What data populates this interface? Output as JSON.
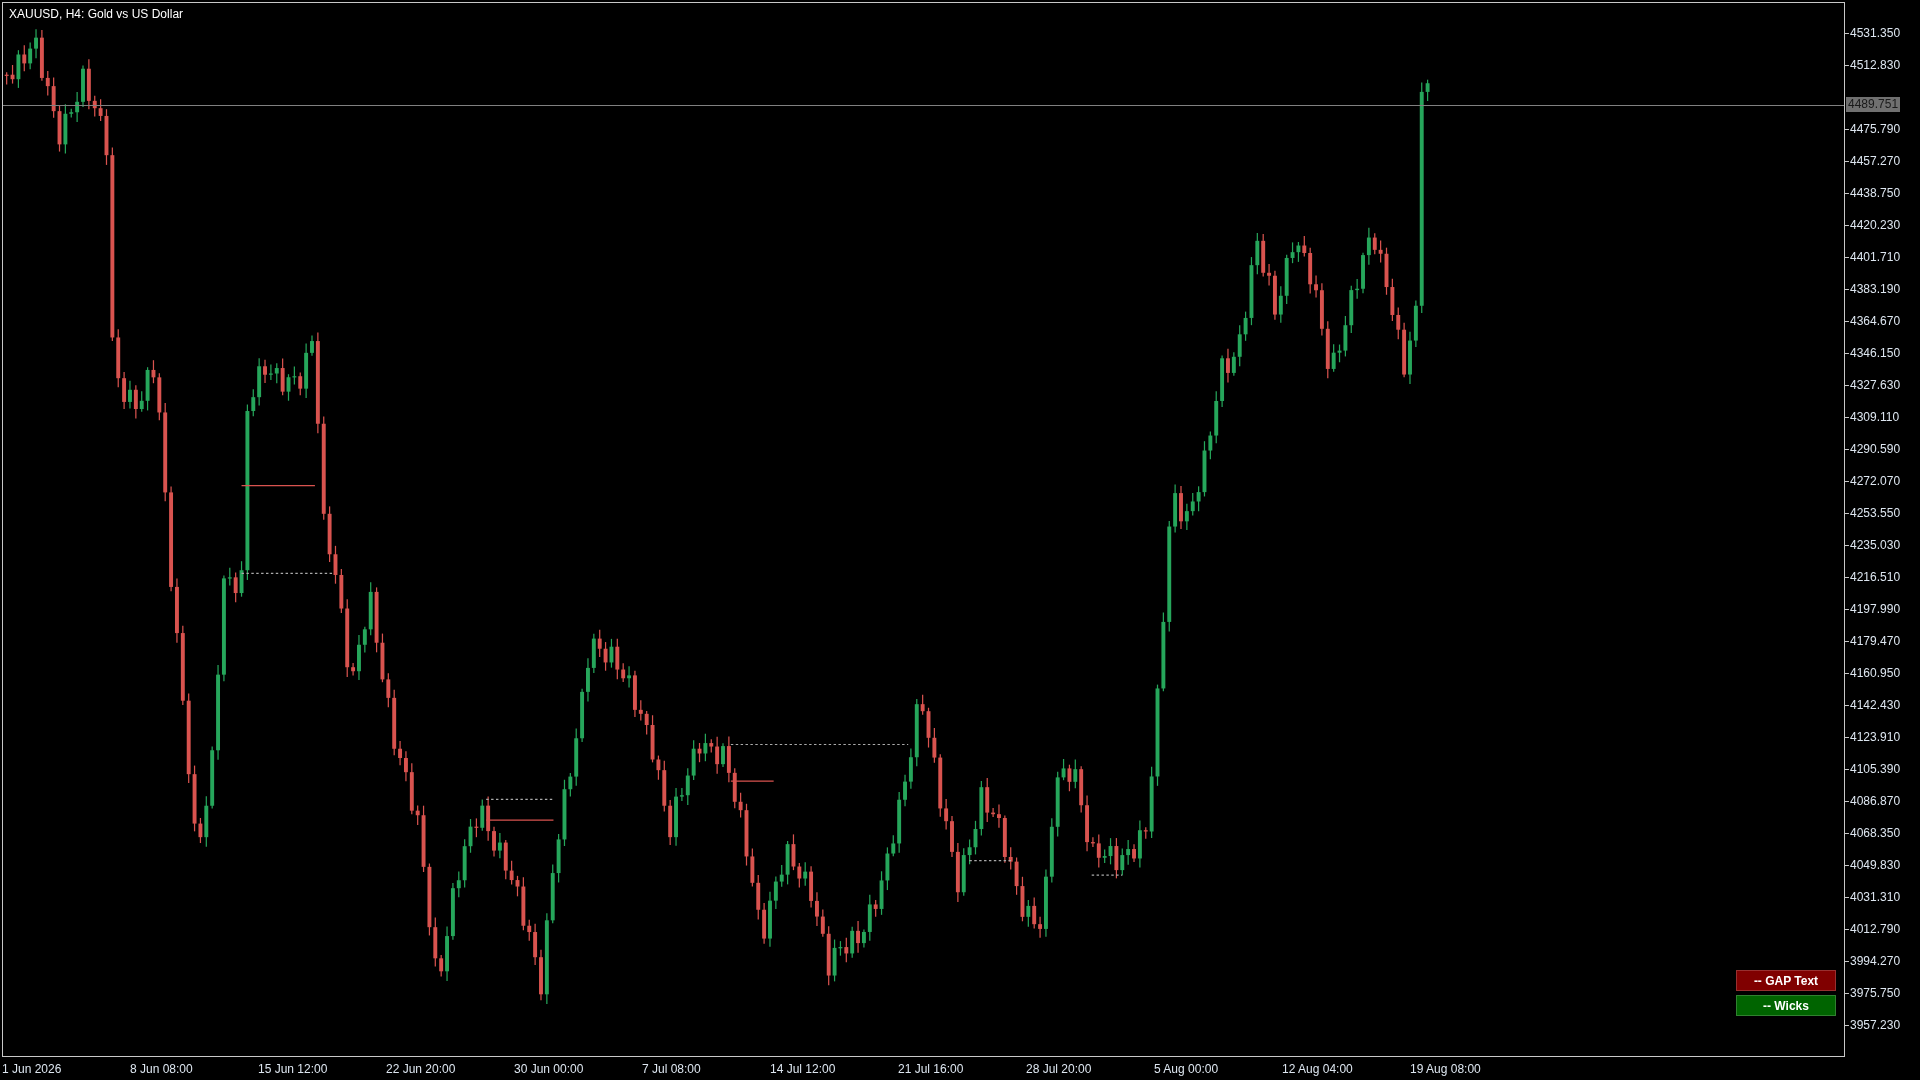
{
  "chart": {
    "title": "XAUUSD, H4:  Gold vs US Dollar"
  },
  "price_axis": [
    {
      "kind": "tick",
      "label": "4531.350"
    },
    {
      "kind": "tick",
      "label": "4512.830"
    },
    {
      "kind": "current_price",
      "label": "4489.751"
    },
    {
      "kind": "tick",
      "label": "4475.790"
    },
    {
      "kind": "tick",
      "label": "4457.270"
    },
    {
      "kind": "tick",
      "label": "4438.750"
    },
    {
      "kind": "tick",
      "label": "4420.230"
    },
    {
      "kind": "tick",
      "label": "4401.710"
    },
    {
      "kind": "tick",
      "label": "4383.190"
    },
    {
      "kind": "tick",
      "label": "4364.670"
    },
    {
      "kind": "tick",
      "label": "4346.150"
    },
    {
      "kind": "tick",
      "label": "4327.630"
    },
    {
      "kind": "tick",
      "label": "4309.110"
    },
    {
      "kind": "tick",
      "label": "4290.590"
    },
    {
      "kind": "tick",
      "label": "4272.070"
    },
    {
      "kind": "tick",
      "label": "4253.550"
    },
    {
      "kind": "tick",
      "label": "4235.030"
    },
    {
      "kind": "tick",
      "label": "4216.510"
    },
    {
      "kind": "tick",
      "label": "4197.990"
    },
    {
      "kind": "tick",
      "label": "4179.470"
    },
    {
      "kind": "tick",
      "label": "4160.950"
    },
    {
      "kind": "tick",
      "label": "4142.430"
    },
    {
      "kind": "tick",
      "label": "4123.910"
    },
    {
      "kind": "tick",
      "label": "4105.390"
    },
    {
      "kind": "tick",
      "label": "4086.870"
    },
    {
      "kind": "tick",
      "label": "4068.350"
    },
    {
      "kind": "tick",
      "label": "4049.830"
    },
    {
      "kind": "tick",
      "label": "4031.310"
    },
    {
      "kind": "tick",
      "label": "4012.790"
    },
    {
      "kind": "tick",
      "label": "3994.270"
    },
    {
      "kind": "tick",
      "label": "3975.750"
    },
    {
      "kind": "tick",
      "label": "3957.230"
    }
  ],
  "time_axis": [
    "1 Jun 2026",
    "8 Jun 08:00",
    "15 Jun 12:00",
    "22 Jun 20:00",
    "30 Jun 00:00",
    "7 Jul 08:00",
    "14 Jul 12:00",
    "21 Jul 16:00",
    "28 Jul 20:00",
    "5 Aug 00:00",
    "12 Aug 04:00",
    "19 Aug 08:00"
  ],
  "buttons": [
    {
      "label": "-- GAP Text",
      "color": "#800000"
    },
    {
      "label": "-- Wicks",
      "color": "#006400"
    }
  ]
}
